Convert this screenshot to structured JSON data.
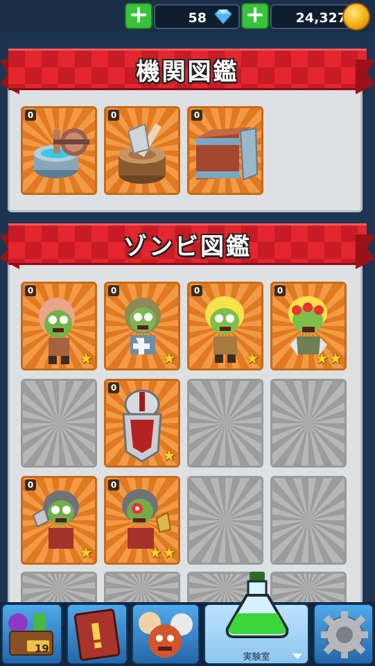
{
  "currency": {
    "gems": "58",
    "coins": "24,327"
  },
  "sections": {
    "machines_title": "機関図鑑",
    "zombies_title": "ゾンビ図鑑"
  },
  "machines": [
    {
      "name": "well-grinder",
      "count": "0"
    },
    {
      "name": "axe-stump",
      "count": "0"
    },
    {
      "name": "wooden-crate",
      "count": "0"
    }
  ],
  "zombies": [
    {
      "name": "zombie-pink-hair",
      "count": "0",
      "stars": "★"
    },
    {
      "name": "zombie-hooded",
      "count": "0",
      "stars": "★"
    },
    {
      "name": "zombie-yellow-hair",
      "count": "0",
      "stars": "★"
    },
    {
      "name": "zombie-eyes",
      "count": "0",
      "stars": "★★"
    },
    {
      "name": "locked",
      "count": "",
      "stars": ""
    },
    {
      "name": "helmet-shield",
      "count": "0",
      "stars": "★"
    },
    {
      "name": "locked",
      "count": "",
      "stars": ""
    },
    {
      "name": "locked",
      "count": "",
      "stars": ""
    },
    {
      "name": "zombie-chainmail",
      "count": "0",
      "stars": "★"
    },
    {
      "name": "zombie-chainmail-red-eye",
      "count": "0",
      "stars": "★★"
    },
    {
      "name": "locked",
      "count": "",
      "stars": ""
    },
    {
      "name": "locked",
      "count": "",
      "stars": ""
    }
  ],
  "nav": {
    "lab_label": "実験室",
    "chest_count": "19"
  },
  "colors": {
    "ribbon": "#e3262f",
    "card": "#f29a45",
    "plus": "#38c43a",
    "nav": "#2467a9"
  }
}
